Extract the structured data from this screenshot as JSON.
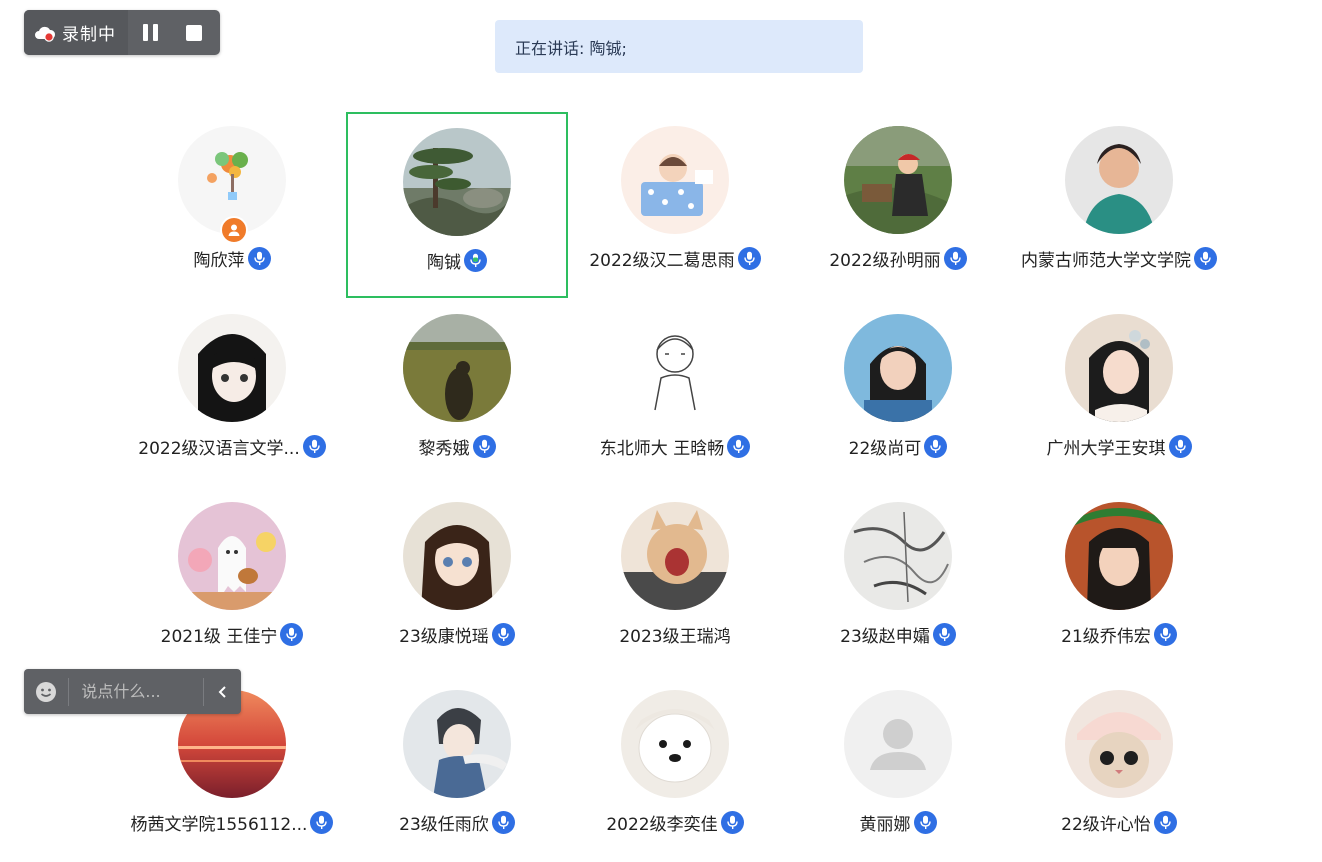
{
  "recording": {
    "label": "录制中",
    "dot_color": "#e53935"
  },
  "speaking": {
    "text": "正在讲话: 陶铖;"
  },
  "chat": {
    "placeholder": "说点什么..."
  },
  "colors": {
    "active_border": "#2dbe5f",
    "mic_blue": "#2f6fe4",
    "host_orange": "#f07b2a"
  },
  "participants": [
    {
      "name": "陶欣萍",
      "host": true,
      "avatar": "flowers-illustration"
    },
    {
      "name": "陶铖",
      "active": true,
      "mic": "speaking",
      "avatar": "pine-landscape"
    },
    {
      "name": "2022级汉二葛思雨",
      "avatar": "cartoon-on-bed"
    },
    {
      "name": "2022级孙明丽",
      "avatar": "person-sitting-grass"
    },
    {
      "name": "内蒙古师范大学文学院",
      "avatar": "woman-portrait"
    },
    {
      "name": "2022级汉语言文学...",
      "avatar": "anime-girl-dark-hair"
    },
    {
      "name": "黎秀娥",
      "avatar": "field-shadow"
    },
    {
      "name": "东北师大 王晗畅",
      "avatar": "line-drawing-girl"
    },
    {
      "name": "22级尚可",
      "avatar": "girl-portrait"
    },
    {
      "name": "广州大学王安琪",
      "avatar": "hanfu-girl"
    },
    {
      "name": "2021级 王佳宁",
      "avatar": "ghost-guitar"
    },
    {
      "name": "23级康悦瑶",
      "avatar": "anime-girl-brown-hair"
    },
    {
      "name": "2023级王瑞鸿",
      "avatar": "yawning-cat",
      "mic": "none"
    },
    {
      "name": "23级赵申孀",
      "avatar": "ink-painting"
    },
    {
      "name": "21级乔伟宏",
      "avatar": "girl-watermelon"
    },
    {
      "name": "杨茜文学院1556112...",
      "avatar": "sunset-sea"
    },
    {
      "name": "23级任雨欣",
      "avatar": "anime-boy-scarf"
    },
    {
      "name": "2022级李奕佳",
      "avatar": "white-dog"
    },
    {
      "name": "黄丽娜",
      "avatar": "default-user"
    },
    {
      "name": "22级许心怡",
      "avatar": "cat-hat"
    }
  ]
}
